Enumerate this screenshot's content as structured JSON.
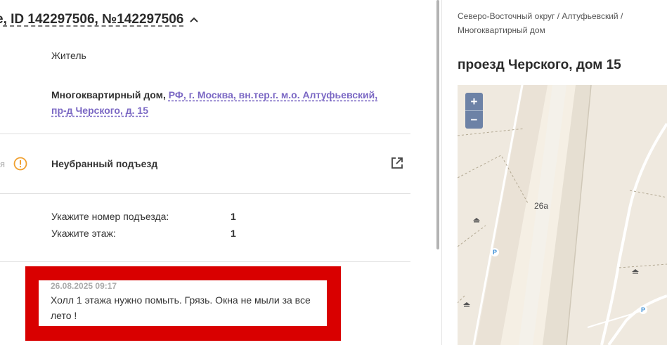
{
  "header": {
    "title": "е, ID 142297506, №142297506"
  },
  "requester": {
    "role": "Житель",
    "object_type": "Многоквартирный дом,",
    "address": "РФ, г. Москва, вн.тер.г. м.о. Алтуфьевский, пр-д Черского, д. 15"
  },
  "issue": {
    "cut_label": "я",
    "title": "Неубранный подъезд"
  },
  "fields": [
    {
      "label": "Укажите номер подъезда:",
      "value": "1"
    },
    {
      "label": "Укажите этаж:",
      "value": "1"
    }
  ],
  "comment": {
    "date": "26.08.2025 09:17",
    "text": "Холл 1 этажа нужно помыть. Грязь. Окна не мыли за все лето !"
  },
  "location": {
    "breadcrumb": "Северо-Восточный округ / Алтуфьевский / Многоквартирный дом",
    "title": "проезд Черского, дом 15"
  },
  "map": {
    "zoom_in": "+",
    "zoom_out": "−",
    "building_label": "26а",
    "parking_label": "P"
  },
  "colors": {
    "accent_link": "#7b68c4",
    "warning": "#f0a030",
    "highlight": "#d90000",
    "map_control": "#6d82a6"
  }
}
